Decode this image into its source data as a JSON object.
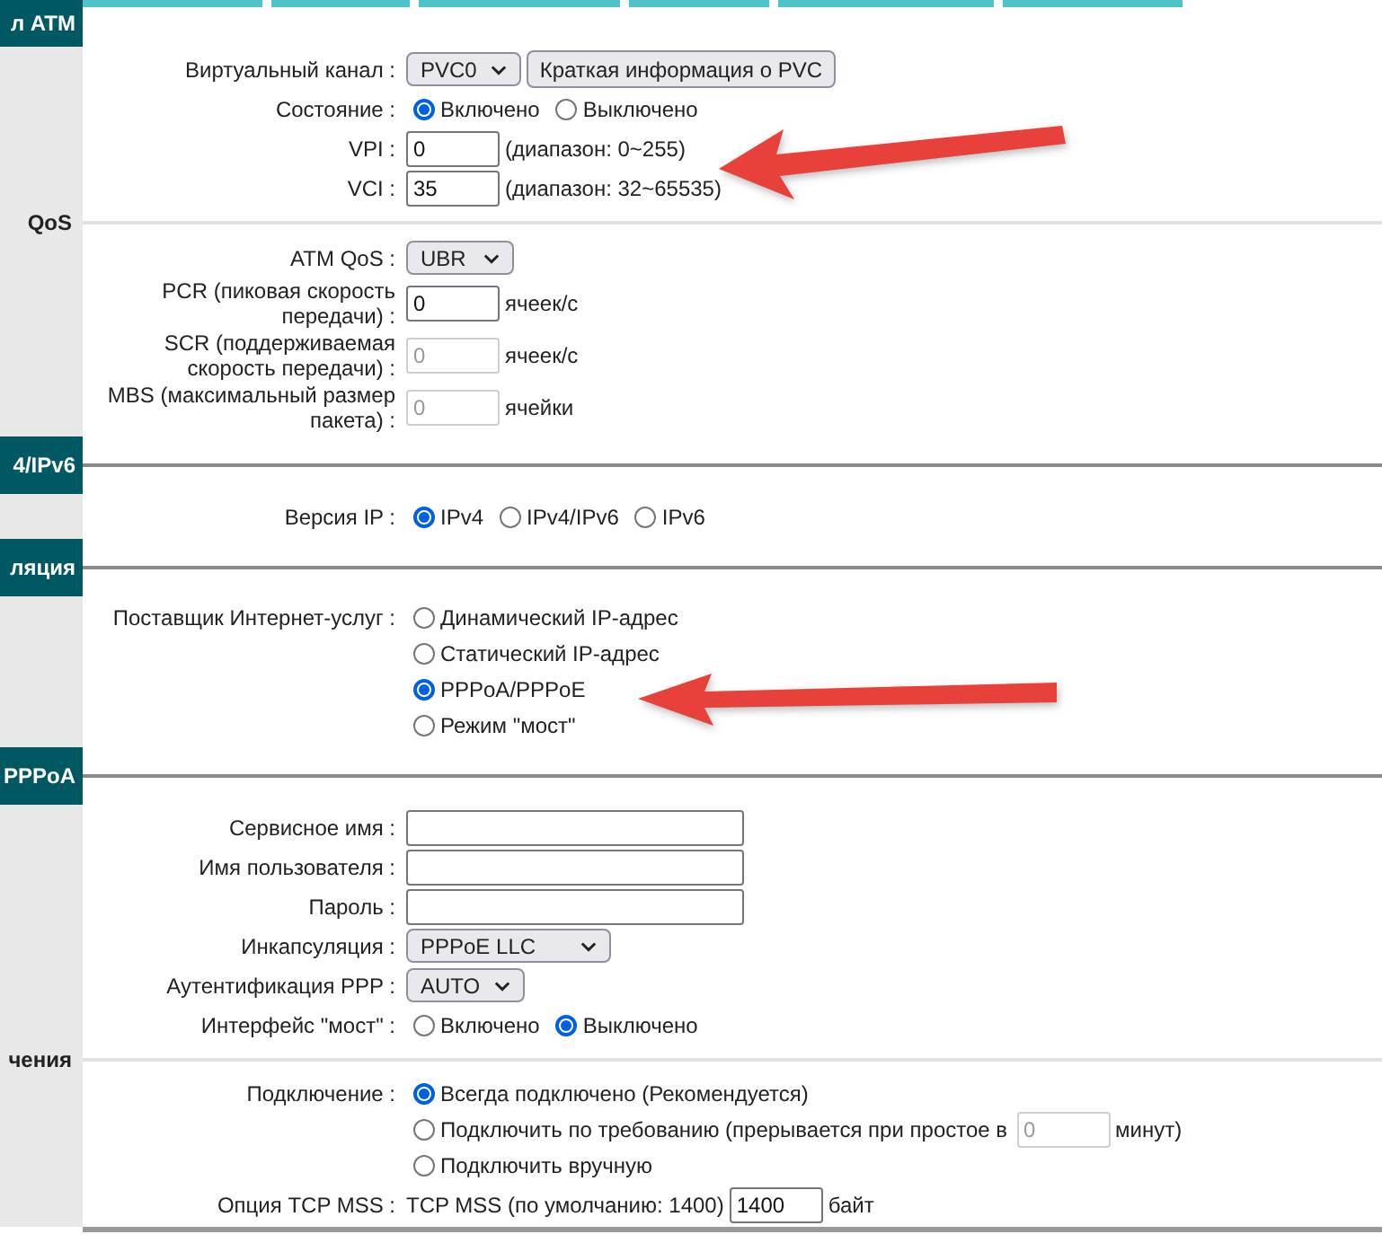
{
  "sections": [
    {
      "side": {
        "text": "л ATM",
        "kind": "band"
      },
      "rows": [
        {
          "label": "Виртуальный канал :",
          "lines": [
            {
              "items": [
                {
                  "kind": "select",
                  "value": "PVC0"
                },
                {
                  "kind": "button",
                  "label": "Краткая информация о PVC"
                }
              ]
            }
          ]
        },
        {
          "label": "Состояние :",
          "lines": [
            {
              "items": [
                {
                  "kind": "radio",
                  "label": "Включено",
                  "selected": true
                },
                {
                  "kind": "radio",
                  "label": "Выключено",
                  "selected": false
                }
              ]
            }
          ]
        },
        {
          "label": "VPI :",
          "lines": [
            {
              "items": [
                {
                  "kind": "input",
                  "value": "0",
                  "disabled": false
                },
                {
                  "kind": "text",
                  "text": "(диапазон: 0~255)"
                }
              ]
            }
          ]
        },
        {
          "label": "VCI :",
          "lines": [
            {
              "items": [
                {
                  "kind": "input",
                  "value": "35",
                  "disabled": false
                },
                {
                  "kind": "text",
                  "text": "(диапазон: 32~65535)"
                }
              ]
            }
          ]
        }
      ]
    },
    {
      "side": {
        "text": "QoS",
        "kind": "plain"
      },
      "rows": [
        {
          "label": "ATM QoS :",
          "lines": [
            {
              "items": [
                {
                  "kind": "select",
                  "value": "UBR"
                }
              ]
            }
          ]
        },
        {
          "label": "PCR (пиковая скорость передачи) :",
          "lines": [
            {
              "items": [
                {
                  "kind": "input",
                  "value": "0",
                  "disabled": false
                },
                {
                  "kind": "text",
                  "text": "ячеек/с"
                }
              ]
            }
          ]
        },
        {
          "label": "SCR (поддерживаемая скорость передачи) :",
          "lines": [
            {
              "items": [
                {
                  "kind": "input",
                  "value": "0",
                  "disabled": true
                },
                {
                  "kind": "text",
                  "text": "ячеек/с"
                }
              ]
            }
          ]
        },
        {
          "label": "MBS (максимальный размер пакета) :",
          "lines": [
            {
              "items": [
                {
                  "kind": "input",
                  "value": "0",
                  "disabled": true
                },
                {
                  "kind": "text",
                  "text": "ячейки"
                }
              ]
            }
          ]
        }
      ]
    },
    {
      "side": {
        "text": "4/IPv6",
        "kind": "band"
      },
      "rows": [
        {
          "label": "Версия IP :",
          "lines": [
            {
              "items": [
                {
                  "kind": "radio",
                  "label": "IPv4",
                  "selected": true
                },
                {
                  "kind": "radio",
                  "label": "IPv4/IPv6",
                  "selected": false
                },
                {
                  "kind": "radio",
                  "label": "IPv6",
                  "selected": false
                }
              ]
            }
          ]
        }
      ]
    },
    {
      "side": {
        "text": "ляция",
        "kind": "band"
      },
      "rows": [
        {
          "label": "Поставщик Интернет-услуг :",
          "lines": [
            {
              "items": [
                {
                  "kind": "radio",
                  "label": "Динамический IP-адрес",
                  "selected": false
                }
              ]
            },
            {
              "items": [
                {
                  "kind": "radio",
                  "label": "Статический IP-адрес",
                  "selected": false
                }
              ]
            },
            {
              "items": [
                {
                  "kind": "radio",
                  "label": "PPPoA/PPPoE",
                  "selected": true
                }
              ]
            },
            {
              "items": [
                {
                  "kind": "radio",
                  "label": "Режим \"мост\"",
                  "selected": false
                }
              ]
            }
          ]
        }
      ]
    },
    {
      "side": {
        "text": "PPPoA",
        "kind": "band"
      },
      "rows": [
        {
          "label": "Сервисное имя :",
          "lines": [
            {
              "items": [
                {
                  "kind": "field"
                }
              ]
            }
          ]
        },
        {
          "label": "Имя пользователя :",
          "lines": [
            {
              "items": [
                {
                  "kind": "field"
                }
              ]
            }
          ]
        },
        {
          "label": "Пароль :",
          "lines": [
            {
              "items": [
                {
                  "kind": "field"
                }
              ]
            }
          ]
        },
        {
          "label": "Инкапсуляция :",
          "lines": [
            {
              "items": [
                {
                  "kind": "select",
                  "value": "PPPoE LLC",
                  "wide": true
                }
              ]
            }
          ]
        },
        {
          "label": "Аутентификация PPP :",
          "lines": [
            {
              "items": [
                {
                  "kind": "select",
                  "value": "AUTO"
                }
              ]
            }
          ]
        },
        {
          "label": "Интерфейс \"мост\" :",
          "lines": [
            {
              "items": [
                {
                  "kind": "radio",
                  "label": "Включено",
                  "selected": false
                },
                {
                  "kind": "radio",
                  "label": "Выключено",
                  "selected": true
                }
              ]
            }
          ]
        }
      ]
    },
    {
      "side": {
        "text": "чения",
        "kind": "plain"
      },
      "rows": [
        {
          "label": "Подключение :",
          "lines": [
            {
              "items": [
                {
                  "kind": "radio",
                  "label": "Всегда подключено (Рекомендуется)",
                  "selected": true
                }
              ]
            },
            {
              "items": [
                {
                  "kind": "radio",
                  "label": "Подключить по требованию (прерывается при простое в",
                  "selected": false
                },
                {
                  "kind": "input",
                  "value": "0",
                  "disabled": true
                },
                {
                  "kind": "text",
                  "text": "минут)"
                }
              ]
            },
            {
              "items": [
                {
                  "kind": "radio",
                  "label": "Подключить вручную",
                  "selected": false
                }
              ]
            }
          ]
        },
        {
          "label": "Опция TCP MSS :",
          "lines": [
            {
              "items": [
                {
                  "kind": "text",
                  "text": "TCP MSS (по умолчанию: 1400)"
                },
                {
                  "kind": "input",
                  "value": "1400",
                  "disabled": false
                },
                {
                  "kind": "text",
                  "text": "байт"
                }
              ]
            }
          ]
        }
      ]
    }
  ]
}
